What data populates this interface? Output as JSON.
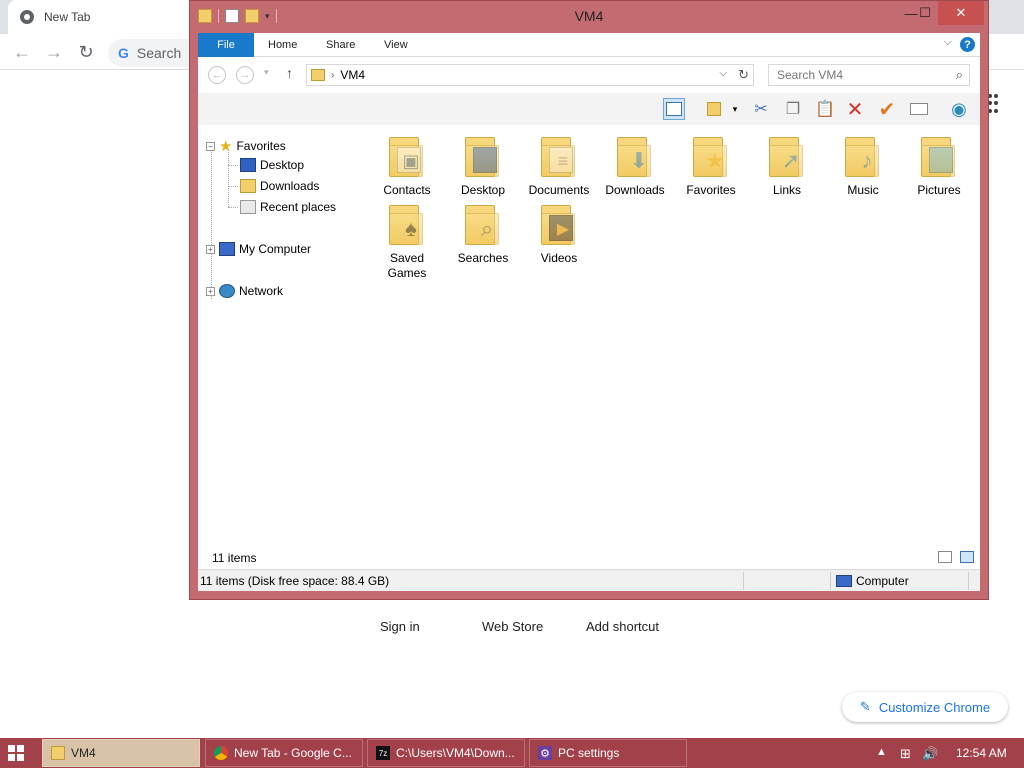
{
  "chrome": {
    "tab_title": "New Tab",
    "omnibox_text": "Search",
    "ntp_links": [
      "Sign in",
      "Web Store",
      "Add shortcut"
    ],
    "customize_label": "Customize Chrome"
  },
  "window": {
    "title": "VM4",
    "accent_color": "#c36b71",
    "ribbon_tabs": [
      "File",
      "Home",
      "Share",
      "View"
    ],
    "address": {
      "path": "VM4",
      "search_placeholder": "Search VM4"
    },
    "nav": {
      "favorites": "Favorites",
      "favorites_children": [
        "Desktop",
        "Downloads",
        "Recent places"
      ],
      "my_computer": "My Computer",
      "network": "Network"
    },
    "items": [
      {
        "label": "Contacts",
        "icon": "contacts-icon"
      },
      {
        "label": "Desktop",
        "icon": "desktop-icon"
      },
      {
        "label": "Documents",
        "icon": "documents-icon"
      },
      {
        "label": "Downloads",
        "icon": "downloads-icon"
      },
      {
        "label": "Favorites",
        "icon": "favorites-icon"
      },
      {
        "label": "Links",
        "icon": "links-icon"
      },
      {
        "label": "Music",
        "icon": "music-icon"
      },
      {
        "label": "Pictures",
        "icon": "pictures-icon"
      },
      {
        "label": "Saved Games",
        "icon": "saved-games-icon"
      },
      {
        "label": "Searches",
        "icon": "searches-icon"
      },
      {
        "label": "Videos",
        "icon": "videos-icon"
      }
    ],
    "item_count": "11 items",
    "status_text": "11 items (Disk free space: 88.4 GB)",
    "status_location": "Computer"
  },
  "taskbar": {
    "color": "#a3414a",
    "tasks": [
      "VM4",
      "New Tab - Google C...",
      "C:\\Users\\VM4\\Down...",
      "PC settings"
    ],
    "clock": "12:54 AM"
  }
}
